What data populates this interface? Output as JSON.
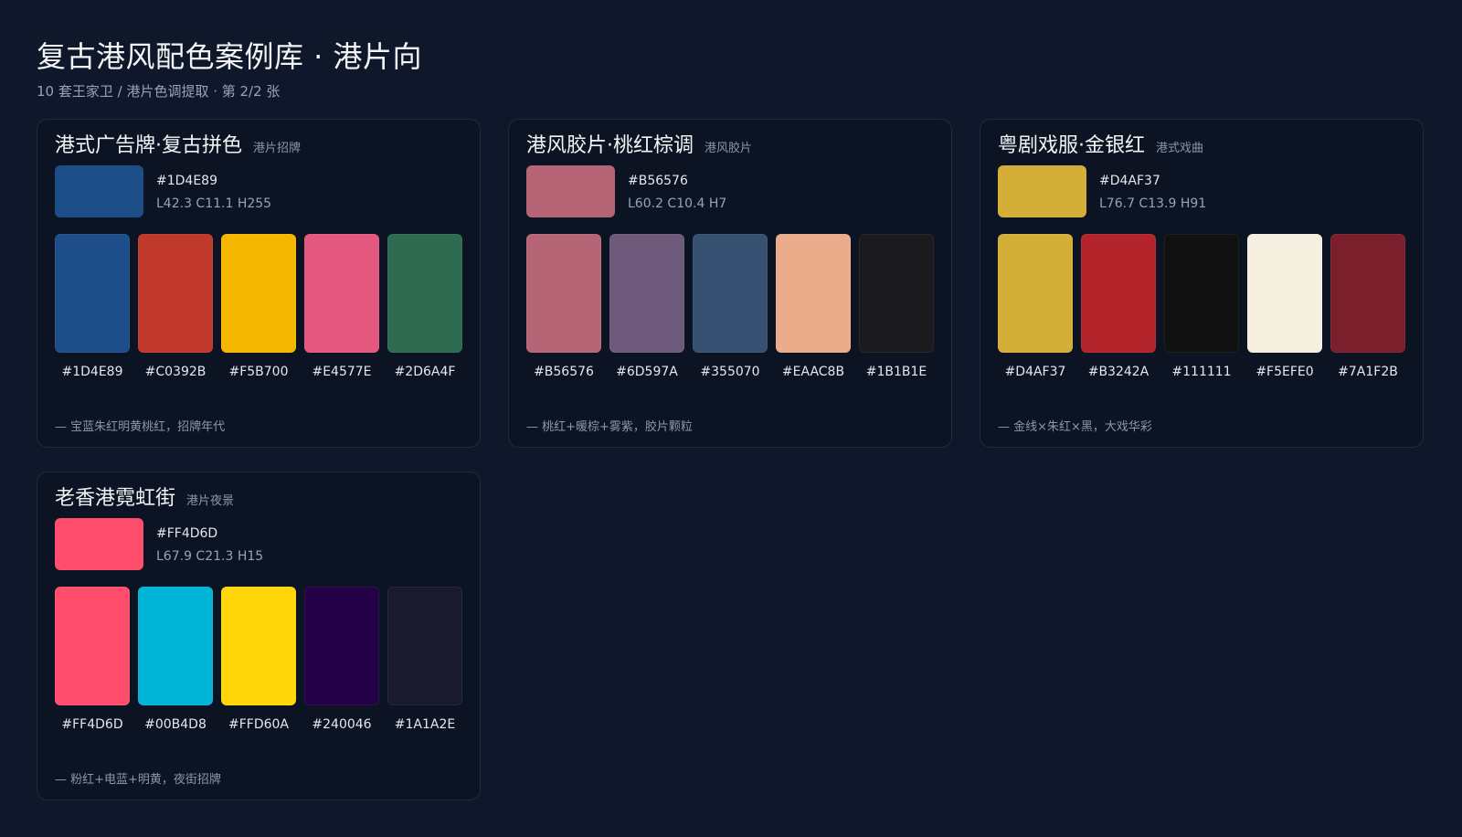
{
  "header": {
    "title": "复古港风配色案例库 · 港片向",
    "subtitle": "10 套王家卫 / 港片色调提取 · 第 2/2 张"
  },
  "cards": [
    {
      "title": "港式广告牌·复古拼色",
      "tag": "港片招牌",
      "primary": {
        "hex": "#1D4E89",
        "lch": "L42.3 C11.1 H255",
        "color": "#1D4E89"
      },
      "swatches": [
        {
          "hex": "#1D4E89",
          "color": "#1D4E89"
        },
        {
          "hex": "#C0392B",
          "color": "#C0392B"
        },
        {
          "hex": "#F5B700",
          "color": "#F5B700"
        },
        {
          "hex": "#E4577E",
          "color": "#E4577E"
        },
        {
          "hex": "#2D6A4F",
          "color": "#2D6A4F"
        }
      ],
      "note": "— 宝蓝朱红明黄桃红，招牌年代"
    },
    {
      "title": "港风胶片·桃红棕调",
      "tag": "港风胶片",
      "primary": {
        "hex": "#B56576",
        "lch": "L60.2 C10.4 H7",
        "color": "#B56576"
      },
      "swatches": [
        {
          "hex": "#B56576",
          "color": "#B56576"
        },
        {
          "hex": "#6D597A",
          "color": "#6D597A"
        },
        {
          "hex": "#355070",
          "color": "#355070"
        },
        {
          "hex": "#EAAC8B",
          "color": "#EAAC8B"
        },
        {
          "hex": "#1B1B1E",
          "color": "#1B1B1E"
        }
      ],
      "note": "— 桃红+暖棕+雾紫，胶片颗粒"
    },
    {
      "title": "粤剧戏服·金银红",
      "tag": "港式戏曲",
      "primary": {
        "hex": "#D4AF37",
        "lch": "L76.7 C13.9 H91",
        "color": "#D4AF37"
      },
      "swatches": [
        {
          "hex": "#D4AF37",
          "color": "#D4AF37"
        },
        {
          "hex": "#B3242A",
          "color": "#B3242A"
        },
        {
          "hex": "#111111",
          "color": "#111111"
        },
        {
          "hex": "#F5EFE0",
          "color": "#F5EFE0"
        },
        {
          "hex": "#7A1F2B",
          "color": "#7A1F2B"
        }
      ],
      "note": "— 金线×朱红×黑，大戏华彩"
    },
    {
      "title": "老香港霓虹街",
      "tag": "港片夜景",
      "primary": {
        "hex": "#FF4D6D",
        "lch": "L67.9 C21.3 H15",
        "color": "#FF4D6D"
      },
      "swatches": [
        {
          "hex": "#FF4D6D",
          "color": "#FF4D6D"
        },
        {
          "hex": "#00B4D8",
          "color": "#00B4D8"
        },
        {
          "hex": "#FFD60A",
          "color": "#FFD60A"
        },
        {
          "hex": "#240046",
          "color": "#240046"
        },
        {
          "hex": "#1A1A2E",
          "color": "#1A1A2E"
        }
      ],
      "note": "— 粉红+电蓝+明黄，夜街招牌"
    }
  ]
}
